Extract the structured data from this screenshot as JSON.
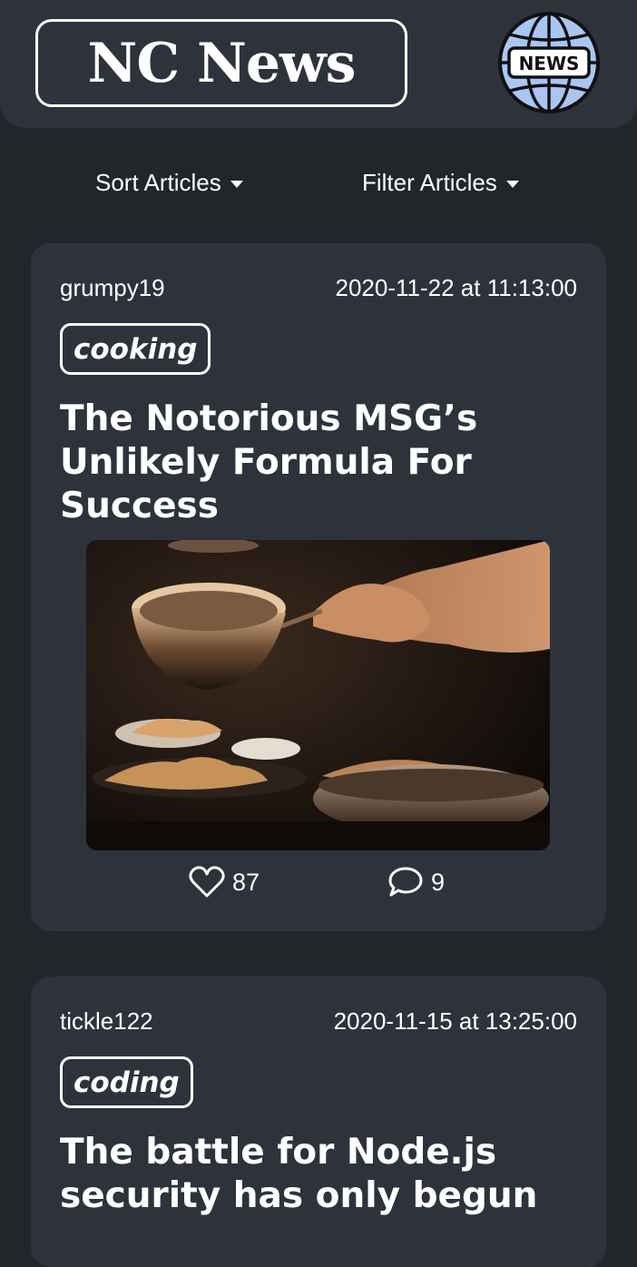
{
  "header": {
    "logo_text": "NC News",
    "badge_text": "NEWS"
  },
  "controls": {
    "sort_label": "Sort Articles",
    "filter_label": "Filter Articles"
  },
  "articles": [
    {
      "author": "grumpy19",
      "date": "2020-11-22 at 11:13:00",
      "topic": "cooking",
      "title": "The Notorious MSG’s Unlikely Formula For Success",
      "votes": "87",
      "comments": "9"
    },
    {
      "author": "tickle122",
      "date": "2020-11-15 at 13:25:00",
      "topic": "coding",
      "title": "The battle for Node.js security has only begun"
    }
  ]
}
